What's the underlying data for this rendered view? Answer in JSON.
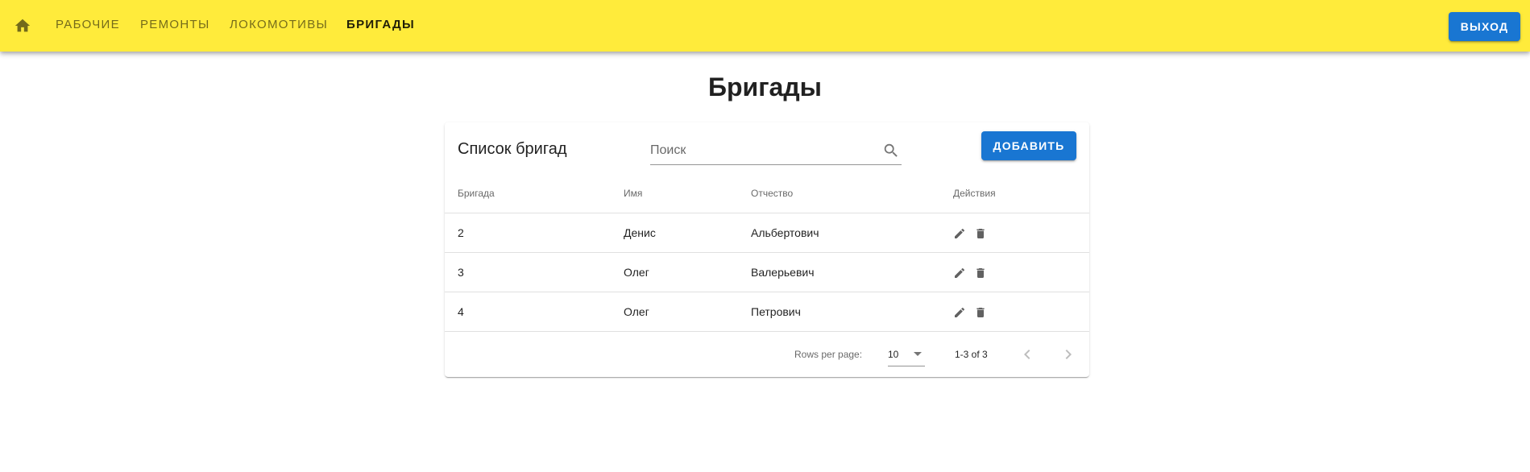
{
  "nav": {
    "home_icon": "home-icon",
    "items": [
      {
        "label": "Рабочие",
        "active": false
      },
      {
        "label": "Ремонты",
        "active": false
      },
      {
        "label": "Локомотивы",
        "active": false
      },
      {
        "label": "Бригады",
        "active": true
      }
    ],
    "logout_label": "Выход"
  },
  "page": {
    "title": "Бригады"
  },
  "card": {
    "title": "Список бригад",
    "search_placeholder": "Поиск",
    "search_value": "",
    "add_label": "Добавить"
  },
  "table": {
    "headers": [
      "Бригада",
      "Имя",
      "Отчество",
      "Действия"
    ],
    "rows": [
      {
        "brigade": "2",
        "name": "Денис",
        "patronymic": "Альбертович"
      },
      {
        "brigade": "3",
        "name": "Олег",
        "patronymic": "Валерьевич"
      },
      {
        "brigade": "4",
        "name": "Олег",
        "patronymic": "Петрович"
      }
    ],
    "action_icons": [
      "pencil-icon",
      "trash-icon"
    ]
  },
  "footer": {
    "rows_per_page_label": "Rows per page:",
    "rows_per_page_value": "10",
    "range": "1-3 of 3"
  },
  "colors": {
    "appbar": "#ffeb3b",
    "primary": "#1976d2"
  }
}
